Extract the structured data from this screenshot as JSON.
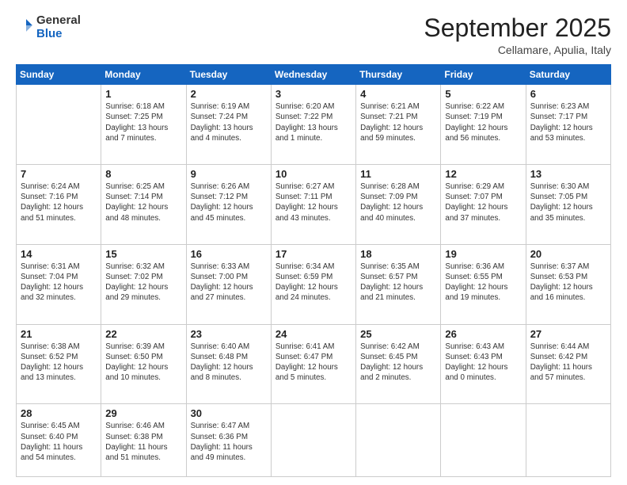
{
  "header": {
    "logo_general": "General",
    "logo_blue": "Blue",
    "month_title": "September 2025",
    "location": "Cellamare, Apulia, Italy"
  },
  "days_of_week": [
    "Sunday",
    "Monday",
    "Tuesday",
    "Wednesday",
    "Thursday",
    "Friday",
    "Saturday"
  ],
  "weeks": [
    [
      {
        "day": "",
        "sunrise": "",
        "sunset": "",
        "daylight": ""
      },
      {
        "day": "1",
        "sunrise": "Sunrise: 6:18 AM",
        "sunset": "Sunset: 7:25 PM",
        "daylight": "Daylight: 13 hours and 7 minutes."
      },
      {
        "day": "2",
        "sunrise": "Sunrise: 6:19 AM",
        "sunset": "Sunset: 7:24 PM",
        "daylight": "Daylight: 13 hours and 4 minutes."
      },
      {
        "day": "3",
        "sunrise": "Sunrise: 6:20 AM",
        "sunset": "Sunset: 7:22 PM",
        "daylight": "Daylight: 13 hours and 1 minute."
      },
      {
        "day": "4",
        "sunrise": "Sunrise: 6:21 AM",
        "sunset": "Sunset: 7:21 PM",
        "daylight": "Daylight: 12 hours and 59 minutes."
      },
      {
        "day": "5",
        "sunrise": "Sunrise: 6:22 AM",
        "sunset": "Sunset: 7:19 PM",
        "daylight": "Daylight: 12 hours and 56 minutes."
      },
      {
        "day": "6",
        "sunrise": "Sunrise: 6:23 AM",
        "sunset": "Sunset: 7:17 PM",
        "daylight": "Daylight: 12 hours and 53 minutes."
      }
    ],
    [
      {
        "day": "7",
        "sunrise": "Sunrise: 6:24 AM",
        "sunset": "Sunset: 7:16 PM",
        "daylight": "Daylight: 12 hours and 51 minutes."
      },
      {
        "day": "8",
        "sunrise": "Sunrise: 6:25 AM",
        "sunset": "Sunset: 7:14 PM",
        "daylight": "Daylight: 12 hours and 48 minutes."
      },
      {
        "day": "9",
        "sunrise": "Sunrise: 6:26 AM",
        "sunset": "Sunset: 7:12 PM",
        "daylight": "Daylight: 12 hours and 45 minutes."
      },
      {
        "day": "10",
        "sunrise": "Sunrise: 6:27 AM",
        "sunset": "Sunset: 7:11 PM",
        "daylight": "Daylight: 12 hours and 43 minutes."
      },
      {
        "day": "11",
        "sunrise": "Sunrise: 6:28 AM",
        "sunset": "Sunset: 7:09 PM",
        "daylight": "Daylight: 12 hours and 40 minutes."
      },
      {
        "day": "12",
        "sunrise": "Sunrise: 6:29 AM",
        "sunset": "Sunset: 7:07 PM",
        "daylight": "Daylight: 12 hours and 37 minutes."
      },
      {
        "day": "13",
        "sunrise": "Sunrise: 6:30 AM",
        "sunset": "Sunset: 7:05 PM",
        "daylight": "Daylight: 12 hours and 35 minutes."
      }
    ],
    [
      {
        "day": "14",
        "sunrise": "Sunrise: 6:31 AM",
        "sunset": "Sunset: 7:04 PM",
        "daylight": "Daylight: 12 hours and 32 minutes."
      },
      {
        "day": "15",
        "sunrise": "Sunrise: 6:32 AM",
        "sunset": "Sunset: 7:02 PM",
        "daylight": "Daylight: 12 hours and 29 minutes."
      },
      {
        "day": "16",
        "sunrise": "Sunrise: 6:33 AM",
        "sunset": "Sunset: 7:00 PM",
        "daylight": "Daylight: 12 hours and 27 minutes."
      },
      {
        "day": "17",
        "sunrise": "Sunrise: 6:34 AM",
        "sunset": "Sunset: 6:59 PM",
        "daylight": "Daylight: 12 hours and 24 minutes."
      },
      {
        "day": "18",
        "sunrise": "Sunrise: 6:35 AM",
        "sunset": "Sunset: 6:57 PM",
        "daylight": "Daylight: 12 hours and 21 minutes."
      },
      {
        "day": "19",
        "sunrise": "Sunrise: 6:36 AM",
        "sunset": "Sunset: 6:55 PM",
        "daylight": "Daylight: 12 hours and 19 minutes."
      },
      {
        "day": "20",
        "sunrise": "Sunrise: 6:37 AM",
        "sunset": "Sunset: 6:53 PM",
        "daylight": "Daylight: 12 hours and 16 minutes."
      }
    ],
    [
      {
        "day": "21",
        "sunrise": "Sunrise: 6:38 AM",
        "sunset": "Sunset: 6:52 PM",
        "daylight": "Daylight: 12 hours and 13 minutes."
      },
      {
        "day": "22",
        "sunrise": "Sunrise: 6:39 AM",
        "sunset": "Sunset: 6:50 PM",
        "daylight": "Daylight: 12 hours and 10 minutes."
      },
      {
        "day": "23",
        "sunrise": "Sunrise: 6:40 AM",
        "sunset": "Sunset: 6:48 PM",
        "daylight": "Daylight: 12 hours and 8 minutes."
      },
      {
        "day": "24",
        "sunrise": "Sunrise: 6:41 AM",
        "sunset": "Sunset: 6:47 PM",
        "daylight": "Daylight: 12 hours and 5 minutes."
      },
      {
        "day": "25",
        "sunrise": "Sunrise: 6:42 AM",
        "sunset": "Sunset: 6:45 PM",
        "daylight": "Daylight: 12 hours and 2 minutes."
      },
      {
        "day": "26",
        "sunrise": "Sunrise: 6:43 AM",
        "sunset": "Sunset: 6:43 PM",
        "daylight": "Daylight: 12 hours and 0 minutes."
      },
      {
        "day": "27",
        "sunrise": "Sunrise: 6:44 AM",
        "sunset": "Sunset: 6:42 PM",
        "daylight": "Daylight: 11 hours and 57 minutes."
      }
    ],
    [
      {
        "day": "28",
        "sunrise": "Sunrise: 6:45 AM",
        "sunset": "Sunset: 6:40 PM",
        "daylight": "Daylight: 11 hours and 54 minutes."
      },
      {
        "day": "29",
        "sunrise": "Sunrise: 6:46 AM",
        "sunset": "Sunset: 6:38 PM",
        "daylight": "Daylight: 11 hours and 51 minutes."
      },
      {
        "day": "30",
        "sunrise": "Sunrise: 6:47 AM",
        "sunset": "Sunset: 6:36 PM",
        "daylight": "Daylight: 11 hours and 49 minutes."
      },
      {
        "day": "",
        "sunrise": "",
        "sunset": "",
        "daylight": ""
      },
      {
        "day": "",
        "sunrise": "",
        "sunset": "",
        "daylight": ""
      },
      {
        "day": "",
        "sunrise": "",
        "sunset": "",
        "daylight": ""
      },
      {
        "day": "",
        "sunrise": "",
        "sunset": "",
        "daylight": ""
      }
    ]
  ]
}
